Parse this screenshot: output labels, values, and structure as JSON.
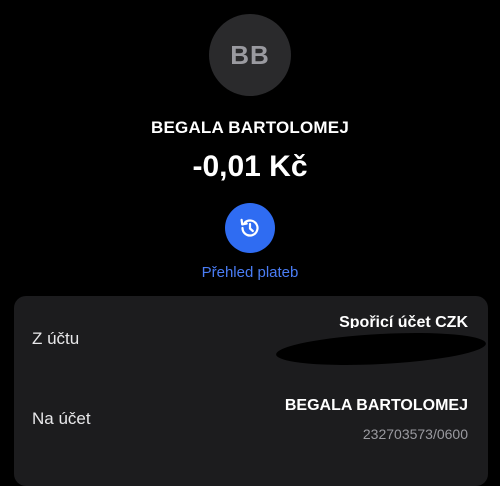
{
  "header": {
    "avatar_initials": "BB",
    "name": "BEGALA BARTOLOMEJ",
    "amount": "-0,01 Kč"
  },
  "history": {
    "label": "Přehled plateb",
    "icon": "history-icon",
    "color": "#2f6cf2"
  },
  "details": {
    "from_label": "Z účtu",
    "from_value": "Spořicí účet CZK",
    "to_label": "Na účet",
    "to_name": "BEGALA BARTOLOMEJ",
    "to_account": "232703573/0600"
  }
}
